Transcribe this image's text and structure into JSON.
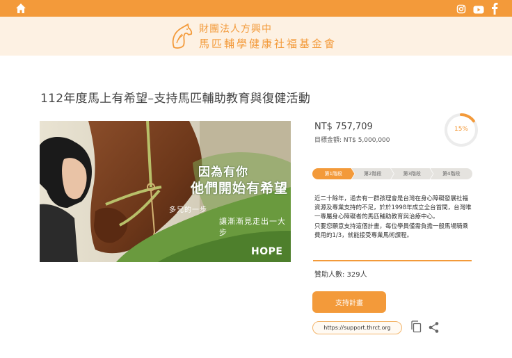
{
  "topbar": {
    "home_icon": "home-icon",
    "social_icons": [
      "instagram-icon",
      "youtube-icon",
      "facebook-icon"
    ],
    "color": "#f39a3a"
  },
  "header": {
    "org_line1": "財團法人方興中",
    "org_line2": "馬匹輔學健康社福基金會",
    "logo_icon": "horse-logo-icon",
    "background": "#fdf1e3"
  },
  "page": {
    "title": "112年度馬上有希望–支持馬匹輔助教育與復健活動"
  },
  "hero": {
    "text_line1": "因為有你",
    "text_line2": "他們開始有希望",
    "text_line3": "多兄的一步",
    "text_line4": "讓漸漸見走出一大步",
    "logo_text": "HOPE"
  },
  "funding": {
    "raised": "NT$ 757,709",
    "target": "目標金額: NT$ 5,000,000",
    "progress_percent": 15,
    "progress_label": "15%"
  },
  "steps": [
    "第1階段",
    "第2階段",
    "第3階段",
    "第4階段"
  ],
  "description": {
    "para1": "近二十餘年，過去有一群孩理會是台灣在身心障礙發展社福資源及專業支持的不足，於於1998年成立全台首間，台灣唯一專屬身心障礙者的馬匹輔助教育與治療中心。",
    "para2": "只要您願意支持這個計畫，每位學員僅需負擔一般馬場騎乘費用的1/3，就能接受專業馬術課程。"
  },
  "donors": "贊助人數: 329人",
  "support_button": "支持計畫",
  "share": {
    "url": "https://support.thrct.org",
    "copy_icon": "copy-icon",
    "share_icon": "share-icon"
  },
  "accent_color": "#f39a3a"
}
